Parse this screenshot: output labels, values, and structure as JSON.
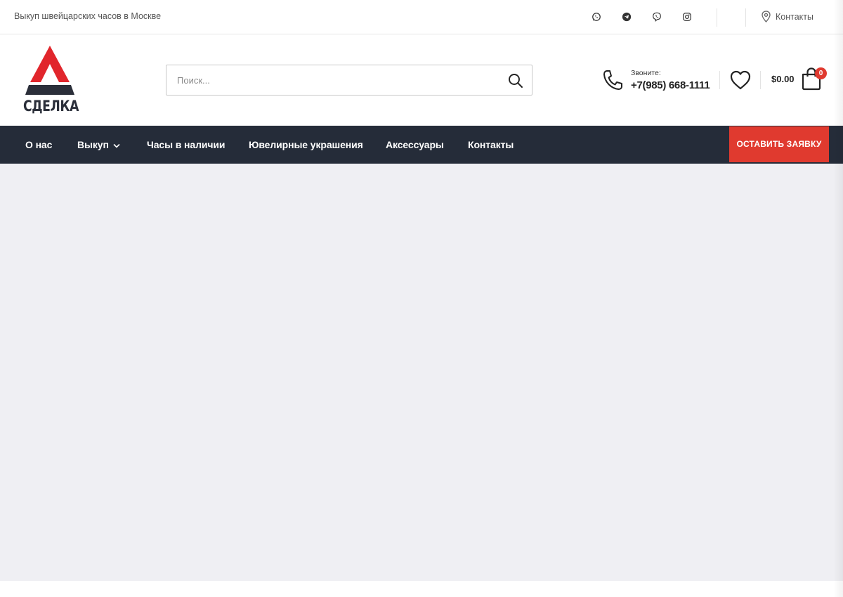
{
  "topbar": {
    "tagline": "Выкуп швейцарских часов в Москве",
    "socials": [
      "whatsapp-icon",
      "telegram-icon",
      "viber-icon",
      "instagram-icon"
    ],
    "contacts_label": "Контакты"
  },
  "header": {
    "logo_text": "СДЕЛКА",
    "search_placeholder": "Поиск...",
    "call_label": "Звоните:",
    "phone_number": "+7(985) 668-1111",
    "cart_total": "$0.00",
    "cart_count": "0"
  },
  "nav": {
    "items": [
      {
        "label": "О нас"
      },
      {
        "label": "Выкуп",
        "has_dropdown": true
      },
      {
        "label": "Часы в наличии"
      },
      {
        "label": "Ювелирные украшения"
      },
      {
        "label": "Аксессуары"
      },
      {
        "label": "Контакты"
      }
    ],
    "cta_label": "ОСТАВИТЬ ЗАЯВКУ"
  },
  "colors": {
    "accent": "#e03a2f",
    "nav_bg": "#252c39",
    "content_bg": "#efeff3"
  }
}
